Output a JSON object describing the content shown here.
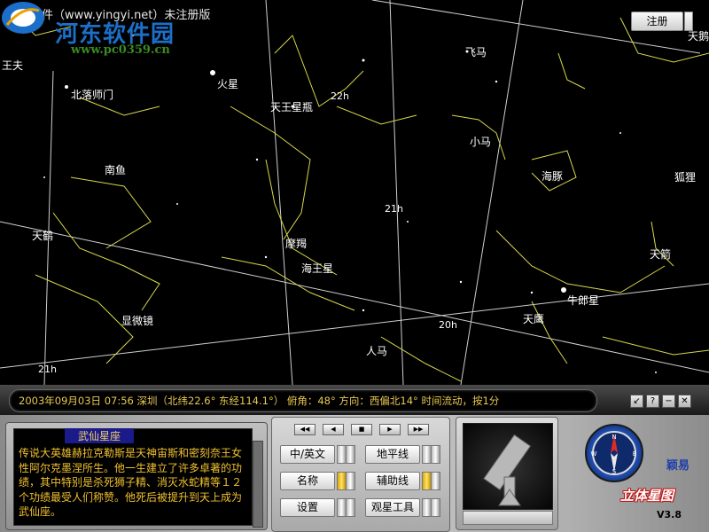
{
  "window_title": "颖易软件（www.yingyi.net）未注册版",
  "watermark": {
    "name": "河东软件园",
    "url": "www.pc0359.cn"
  },
  "register_button": "注册",
  "sky_labels": [
    {
      "id": "wangfu",
      "text": "王夫"
    },
    {
      "id": "beiluoshimen",
      "text": "北落师门"
    },
    {
      "id": "huoxing",
      "text": "火星"
    },
    {
      "id": "tianwangxing",
      "text": "天王星瓶"
    },
    {
      "id": "hour22",
      "text": "22h"
    },
    {
      "id": "feima",
      "text": "飞马"
    },
    {
      "id": "tianxun",
      "text": "天鹅"
    },
    {
      "id": "xiaoma",
      "text": "小马"
    },
    {
      "id": "nanyu",
      "text": "南鱼"
    },
    {
      "id": "haitun",
      "text": "海豚"
    },
    {
      "id": "huli",
      "text": "狐狸"
    },
    {
      "id": "hour21",
      "text": "21h"
    },
    {
      "id": "tianhe",
      "text": "天鹤"
    },
    {
      "id": "mojie",
      "text": "摩羯"
    },
    {
      "id": "haiwangxing",
      "text": "海王星"
    },
    {
      "id": "tianjian",
      "text": "天箭"
    },
    {
      "id": "niulangxing",
      "text": "牛郎星"
    },
    {
      "id": "xianweijing",
      "text": "显微镜"
    },
    {
      "id": "tianying",
      "text": "天鹰"
    },
    {
      "id": "hour20",
      "text": "20h"
    },
    {
      "id": "renma",
      "text": "人马"
    },
    {
      "id": "hour21b",
      "text": "21h"
    }
  ],
  "status": {
    "date": "2003年09月03日",
    "time": "07:56",
    "location": "深圳（北纬22.6° 东经114.1°）",
    "altitude": "俯角：48°",
    "direction": "方向：西偏北14°",
    "flow": "时间流动，按1分"
  },
  "info_panel": {
    "title": "武仙星座",
    "text": "传说大英雄赫拉克勒斯是天神宙斯和密刻奈王女性阿尔克墨涅所生。他一生建立了许多卓著的功绩，其中特别是杀死狮子精、消灭水蛇精等１２个功绩最受人们称赞。他死后被提升到天上成为武仙座。"
  },
  "nav_buttons": [
    "◀◀",
    "◀",
    "■",
    "▶",
    "▶▶"
  ],
  "function_buttons": {
    "lang": "中/英文",
    "horizon": "地平线",
    "name": "名称",
    "aux": "辅助线",
    "settings": "设置",
    "tools": "观星工具"
  },
  "brand": {
    "company": "颖易",
    "product": "立体星图",
    "version": "V3.8"
  },
  "compass_letters": {
    "n": "N",
    "s": "S",
    "e": "E",
    "w": "W"
  }
}
